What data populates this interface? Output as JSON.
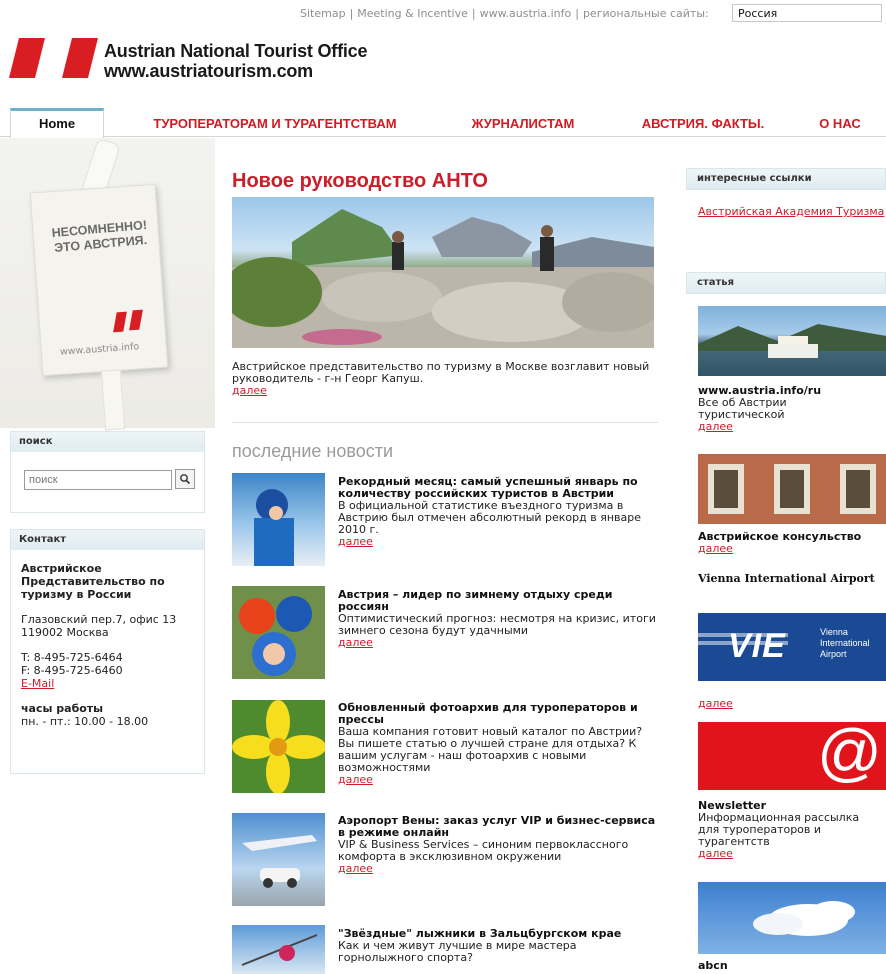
{
  "topbar": {
    "links": [
      "Sitemap",
      "Meeting & Incentive",
      "www.austria.info",
      "региональные сайты:"
    ],
    "region_value": "Россия"
  },
  "logo": {
    "line1": "Austrian National Tourist Office",
    "line2": "www.austriatourism.com",
    "brand_color": "#d81e22"
  },
  "nav": {
    "tabs": [
      "Home",
      "ТУРОПЕРАТОРАМ И ТУРАГЕНТСТВАМ",
      "ЖУРНАЛИСТАМ",
      "АВСТРИЯ. ФАКТЫ.",
      "О НАС"
    ],
    "active": "Home",
    "accent": "#d11a22"
  },
  "tag": {
    "text": "НЕСОМНЕННО! ЭТО АВСТРИЯ.",
    "url": "www.austria.info"
  },
  "search": {
    "heading": "поиск",
    "placeholder": "поиск",
    "button_icon": "magnifier-icon"
  },
  "contact": {
    "heading": "Контакт",
    "org": "Австрийское Представительство по туризму в России",
    "address1": "Глазовский пер.7, офис 13",
    "address2": "119002 Москва",
    "phone": "T: 8-495-725-6464",
    "fax": "F: 8-495-725-6460",
    "email": "E-Mail",
    "hours_label": "часы работы",
    "hours": "пн. - пт.: 10.00 - 18.00"
  },
  "hero": {
    "title": "Новое руководство АНТО",
    "text": "Австрийское представительство по туризму в Москве возглавит новый руководитель - г-н Георг Капуш.",
    "more": "далее"
  },
  "news": {
    "heading": "последние новости",
    "items": [
      {
        "title": "Рекордный месяц: самый успешный январь по количеству российских туристов в Австрии",
        "text": "В официальной статистике въездного туризма в Австрию был отмечен абсолютный рекорд в январе 2010 г.",
        "more": "далее"
      },
      {
        "title": "Австрия – лидер по зимнему отдыху среди россиян",
        "text": "Оптимистический прогноз: несмотря на кризис, итоги зимнего сезона будут удачными",
        "more": "далее"
      },
      {
        "title": "Обновленный фотоархив для туроператоров и прессы",
        "text": "Ваша компания готовит новый каталог по Австрии? Вы пишете статью о лучшей стране для отдыха? К вашим услугам - наш фотоархив с новыми возможностями",
        "more": "далее"
      },
      {
        "title": "Аэропорт Вены: заказ услуг VIP и бизнес-сервиса в режиме онлайн",
        "text": "VIP & Business Services – синоним первоклассного комфорта в эксклюзивном окружении",
        "more": "далее"
      },
      {
        "title": "\"Звёздные\" лыжники в Зальцбургском крае",
        "text": "Как и чем живут лучшие в мире мастера горнолыжного спорта?",
        "more": ""
      }
    ]
  },
  "right": {
    "links_heading": "интересные ссылки",
    "link1": "Австрийская Академия Туризма",
    "article_heading": "статья",
    "a1_title": "www.austria.info/ru",
    "a1_text": "Все об Австрии туристической",
    "a1_more": "далее",
    "a2_title": "Австрийское консульство",
    "a2_more": "далее",
    "a3_title": "Vienna International Airport",
    "vie_mark": "VIE",
    "vie_text": "Vienna International Airport",
    "a3_more": "далее",
    "newsletter_symbol": "@",
    "a4_title": "Newsletter",
    "a4_text": "Информационная рассылка для туроператоров и турагентств",
    "a4_more": "далее",
    "a5_title": "abcn"
  }
}
